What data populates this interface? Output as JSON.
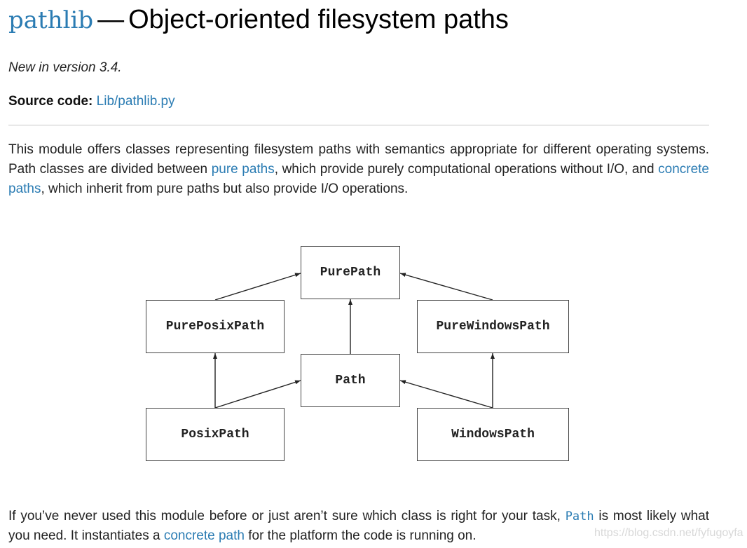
{
  "heading": {
    "module_name": "pathlib",
    "dash": "—",
    "title": "Object-oriented filesystem paths"
  },
  "version_note": "New in version 3.4.",
  "source": {
    "label": "Source code:",
    "link_text": "Lib/pathlib.py"
  },
  "intro": {
    "text_1": "This module offers classes representing filesystem paths with semantics appropriate for different operating systems. Path classes are divided between ",
    "link_pure": "pure paths",
    "text_2": ", which provide purely computational operations without I/O, and ",
    "link_concrete": "concrete paths",
    "text_3": ", which inherit from pure paths but also provide I/O operations."
  },
  "diagram": {
    "nodes": [
      {
        "id": "PurePath",
        "label": "PurePath"
      },
      {
        "id": "PurePosixPath",
        "label": "PurePosixPath"
      },
      {
        "id": "PureWindowsPath",
        "label": "PureWindowsPath"
      },
      {
        "id": "Path",
        "label": "Path"
      },
      {
        "id": "PosixPath",
        "label": "PosixPath"
      },
      {
        "id": "WindowsPath",
        "label": "WindowsPath"
      }
    ],
    "edges": [
      {
        "from": "PurePosixPath",
        "to": "PurePath"
      },
      {
        "from": "PureWindowsPath",
        "to": "PurePath"
      },
      {
        "from": "Path",
        "to": "PurePath"
      },
      {
        "from": "PosixPath",
        "to": "PurePosixPath"
      },
      {
        "from": "PosixPath",
        "to": "Path"
      },
      {
        "from": "WindowsPath",
        "to": "PureWindowsPath"
      },
      {
        "from": "WindowsPath",
        "to": "Path"
      }
    ]
  },
  "closing": {
    "text_1": "If you’ve never used this module before or just aren’t sure which class is right for your task, ",
    "code": "Path",
    "text_2": " is most likely what you need. It instantiates a ",
    "link": "concrete path",
    "text_3": " for the platform the code is running on."
  },
  "watermark": "https://blog.csdn.net/fyfugoyfa",
  "colors": {
    "link": "#2b7cb3",
    "text": "#222222",
    "rule": "#c8c8c8"
  }
}
